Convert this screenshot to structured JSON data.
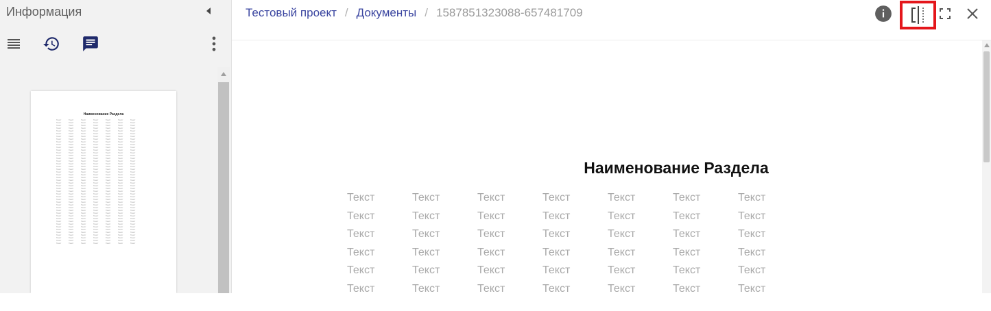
{
  "sidebar": {
    "title": "Информация",
    "tools": [
      "list-icon",
      "history-icon",
      "comment-icon",
      "more-vert-icon"
    ],
    "thumbnail": {
      "title": "Наименование Раздела",
      "cell_text": "Текст",
      "columns": 7,
      "rows": 46
    }
  },
  "header": {
    "breadcrumb": {
      "project": "Тестовый проект",
      "documents": "Документы",
      "current": "1587851323088-657481709",
      "separator": "/"
    },
    "icons": [
      "info-icon",
      "split-view-icon",
      "fullscreen-icon",
      "close-icon"
    ],
    "highlight_color": "#e4161b"
  },
  "document": {
    "section_title": "Наименование Раздела",
    "cell_text": "Текст",
    "columns": 7,
    "visible_rows": 6
  },
  "colors": {
    "link": "#3a45a0",
    "icon": "#1f2a6b",
    "muted_text": "#a9a9a9"
  }
}
